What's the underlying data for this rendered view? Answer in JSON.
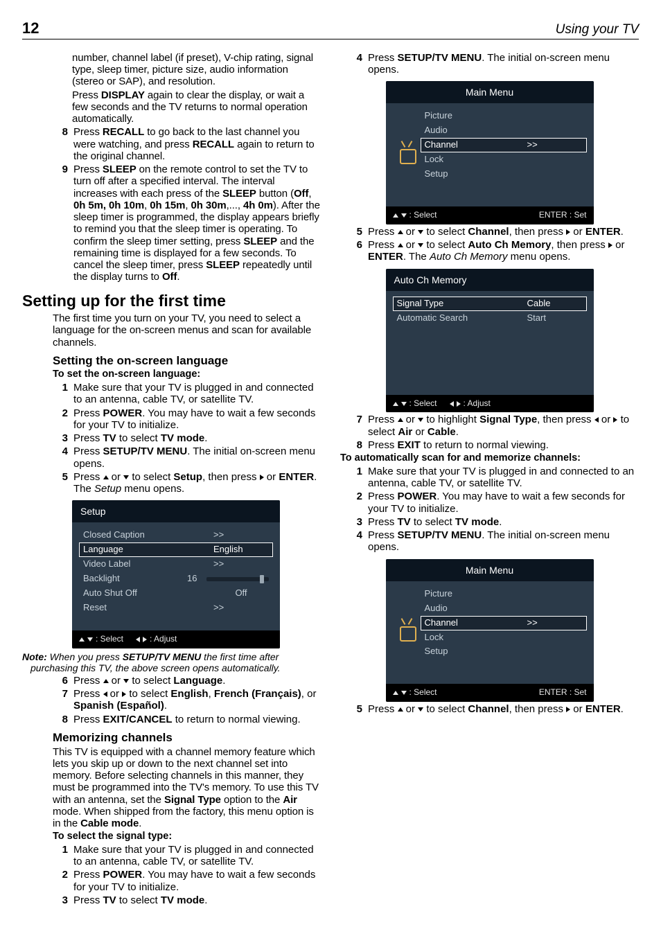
{
  "pageNumber": "12",
  "headerTitle": "Using your TV",
  "left": {
    "introTail": "number, channel label (if preset), V-chip rating, signal type, sleep timer, picture size, audio information (stereo or SAP), and resolution.",
    "displayLine_a": "Press ",
    "displayLine_b": "DISPLAY",
    "displayLine_c": " again to clear the display, or wait a few seconds and the TV returns to normal operation automatically.",
    "item8_a": "Press ",
    "item8_b": "RECALL",
    "item8_c": "  to go back to the last channel you were watching, and press ",
    "item8_d": "RECALL",
    "item8_e": " again to return to the original channel.",
    "item9_a": "Press ",
    "item9_b": "SLEEP",
    "item9_c": " on the remote control to set the TV to turn off after a specified interval. The interval increases with each press of the ",
    "item9_d": "SLEEP",
    "item9_e": " button (",
    "item9_f": "Off",
    "item9_g": ", ",
    "item9_h": "0h 5m, 0h 10m",
    "item9_i": ", ",
    "item9_j": "0h 15m",
    "item9_k": ", ",
    "item9_l": "0h 30m",
    "item9_m": ",..., ",
    "item9_n": "4h 0m",
    "item9_o": "). After the sleep timer is programmed, the display appears briefly to remind you that the sleep timer is operating. To confirm the sleep timer setting, press ",
    "item9_p": "SLEEP",
    "item9_q": " and the remaining time is displayed for a few seconds. To cancel the sleep timer, press ",
    "item9_r": "SLEEP",
    "item9_s": " repeatedly until the display turns to ",
    "item9_t": "Off",
    "item9_u": ".",
    "h1": "Setting up for the first time",
    "p1": "The first time you turn on your TV, you need to select a language for the on-screen menus and scan for available channels.",
    "h2a": "Setting the on-screen language",
    "sub_a": "To set the on-screen language:",
    "s1": "Make sure that your TV is plugged in and connected to an antenna, cable TV, or satellite TV.",
    "s2_a": "Press ",
    "s2_b": "POWER",
    "s2_c": ". You may have to wait a few seconds for your TV to initialize.",
    "s3_a": "Press ",
    "s3_b": "TV",
    "s3_c": " to select ",
    "s3_d": "TV mode",
    "s3_e": ".",
    "s4_a": "Press ",
    "s4_b": "SETUP/TV MENU",
    "s4_c": ". The initial on-screen menu opens.",
    "s5_a": "Press ",
    "s5_b": " or ",
    "s5_c": " to select ",
    "s5_d": "Setup",
    "s5_e": ", then press ",
    "s5_f": " or ",
    "s5_g": "ENTER",
    "s5_h": ". The ",
    "s5_i": "Setup",
    "s5_j": " menu opens.",
    "setupOSD": {
      "title": "Setup",
      "rows": [
        {
          "label": "Closed Caption",
          "val": ">>"
        },
        {
          "label": "Language",
          "val": "English",
          "sel": true
        },
        {
          "label": "Video Label",
          "val": ">>"
        },
        {
          "label": "Backlight",
          "val": "16",
          "slider": 85
        },
        {
          "label": "Auto Shut Off",
          "val": "Off"
        },
        {
          "label": "Reset",
          "val": ">>"
        }
      ],
      "footer": {
        "select": ": Select",
        "adjust": ": Adjust"
      }
    },
    "note_a": "Note:",
    "note_b": " When you press ",
    "note_c": "SETUP/TV MENU",
    "note_d": " the first time after purchasing this TV, the above screen opens automatically.",
    "s6_a": "Press ",
    "s6_b": " or ",
    "s6_c": " to select ",
    "s6_d": "Language",
    "s6_e": ".",
    "s7_a": "Press ",
    "s7_b": " or ",
    "s7_c": " to select ",
    "s7_d": "English",
    "s7_e": ", ",
    "s7_f": "French (Français)",
    "s7_g": ", or ",
    "s7_h": "Spanish (Español)",
    "s7_i": ".",
    "s8_a": "Press ",
    "s8_b": "EXIT/CANCEL",
    "s8_c": " to return to normal viewing.",
    "h2b": "Memorizing channels",
    "p2_a": "This TV is equipped with a channel memory feature which lets you skip up or down to the next channel set into memory. Before selecting channels in this manner, they must be programmed into the TV's memory. To use this TV with an antenna, set the ",
    "p2_b": "Signal Type",
    "p2_c": " option to the ",
    "p2_d": "Air",
    "p2_e": " mode. When shipped from the factory, this menu option is in the ",
    "p2_f": "Cable mode",
    "p2_g": ".",
    "sub_b": "To select the signal type:",
    "m1": "Make sure that your TV is plugged in and connected to an antenna, cable TV, or satellite TV.",
    "m2_a": "Press ",
    "m2_b": "POWER",
    "m2_c": ". You may have to wait a few seconds for your TV to initialize.",
    "m3_a": "Press ",
    "m3_b": "TV",
    "m3_c": " to select ",
    "m3_d": "TV mode",
    "m3_e": "."
  },
  "right": {
    "r4_a": "Press ",
    "r4_b": "SETUP/TV MENU",
    "r4_c": ". The initial on-screen menu opens.",
    "mainOSD": {
      "title": "Main Menu",
      "rows": [
        {
          "label": "Picture"
        },
        {
          "label": "Audio"
        },
        {
          "label": "Channel",
          "val": ">>",
          "sel": true
        },
        {
          "label": "Lock"
        },
        {
          "label": "Setup"
        }
      ],
      "footer": {
        "select": ": Select",
        "set": "ENTER : Set"
      }
    },
    "r5_a": "Press ",
    "r5_b": " or ",
    "r5_c": " to select ",
    "r5_d": "Channel",
    "r5_e": ", then press ",
    "r5_f": " or ",
    "r5_g": "ENTER",
    "r5_h": ".",
    "r6_a": "Press ",
    "r6_b": " or ",
    "r6_c": " to select ",
    "r6_d": "Auto Ch Memory",
    "r6_e": ", then press ",
    "r6_f": " or ",
    "r6_g": "ENTER",
    "r6_h": ". The ",
    "r6_i": "Auto Ch Memory",
    "r6_j": " menu opens.",
    "autoOSD": {
      "title": "Auto Ch Memory",
      "rows": [
        {
          "label": "Signal Type",
          "val": "Cable",
          "sel": true
        },
        {
          "label": "Automatic Search",
          "val": "Start"
        }
      ],
      "footer": {
        "select": ": Select",
        "adjust": ": Adjust"
      }
    },
    "r7_a": "Press ",
    "r7_b": " or ",
    "r7_c": " to highlight ",
    "r7_d": "Signal Type",
    "r7_e": ", then press ",
    "r7_f": " or ",
    "r7_g": " to select ",
    "r7_h": "Air",
    "r7_i": " or ",
    "r7_j": "Cable",
    "r7_k": ".",
    "r8_a": "Press ",
    "r8_b": "EXIT",
    "r8_c": " to return to normal viewing.",
    "sub_c": "To automatically scan for and memorize channels:",
    "a1": "Make sure that your TV is plugged in and connected to an antenna, cable TV, or satellite TV.",
    "a2_a": "Press ",
    "a2_b": "POWER",
    "a2_c": ". You may have to wait a few seconds for your TV to initialize.",
    "a3_a": "Press ",
    "a3_b": "TV",
    "a3_c": " to select ",
    "a3_d": "TV mode",
    "a3_e": ".",
    "a4_a": "Press ",
    "a4_b": "SETUP/TV MENU",
    "a4_c": ". The initial on-screen menu opens.",
    "b5_a": "Press ",
    "b5_b": " or ",
    "b5_c": " to select ",
    "b5_d": "Channel",
    "b5_e": ", then press ",
    "b5_f": " or ",
    "b5_g": "ENTER",
    "b5_h": "."
  }
}
